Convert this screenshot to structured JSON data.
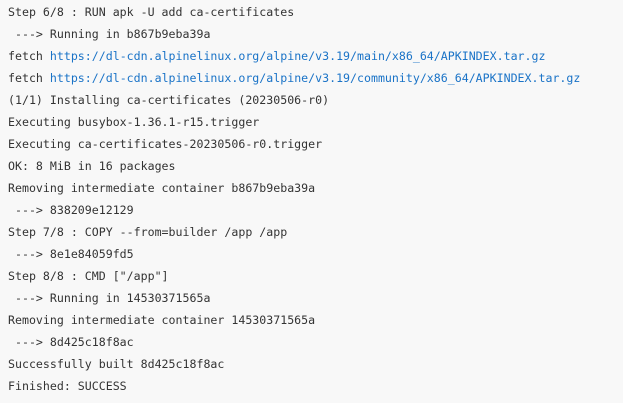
{
  "console": {
    "lines": [
      {
        "text": "Step 6/8 : RUN apk -U add ca-certificates"
      },
      {
        "text": " ---> Running in b867b9eba39a"
      },
      {
        "prefix": "fetch ",
        "link": "https://dl-cdn.alpinelinux.org/alpine/v3.19/main/x86_64/APKINDEX.tar.gz"
      },
      {
        "prefix": "fetch ",
        "link": "https://dl-cdn.alpinelinux.org/alpine/v3.19/community/x86_64/APKINDEX.tar.gz"
      },
      {
        "text": "(1/1) Installing ca-certificates (20230506-r0)"
      },
      {
        "text": "Executing busybox-1.36.1-r15.trigger"
      },
      {
        "text": "Executing ca-certificates-20230506-r0.trigger"
      },
      {
        "text": "OK: 8 MiB in 16 packages"
      },
      {
        "text": "Removing intermediate container b867b9eba39a"
      },
      {
        "text": " ---> 838209e12129"
      },
      {
        "text": "Step 7/8 : COPY --from=builder /app /app"
      },
      {
        "text": " ---> 8e1e84059fd5"
      },
      {
        "text": "Step 8/8 : CMD [\"/app\"]"
      },
      {
        "text": " ---> Running in 14530371565a"
      },
      {
        "text": "Removing intermediate container 14530371565a"
      },
      {
        "text": " ---> 8d425c18f8ac"
      },
      {
        "text": "Successfully built 8d425c18f8ac"
      },
      {
        "text": "Finished: SUCCESS"
      }
    ]
  },
  "colors": {
    "background": "#f8f8f8",
    "text": "#333333",
    "link": "#1a73c7"
  }
}
